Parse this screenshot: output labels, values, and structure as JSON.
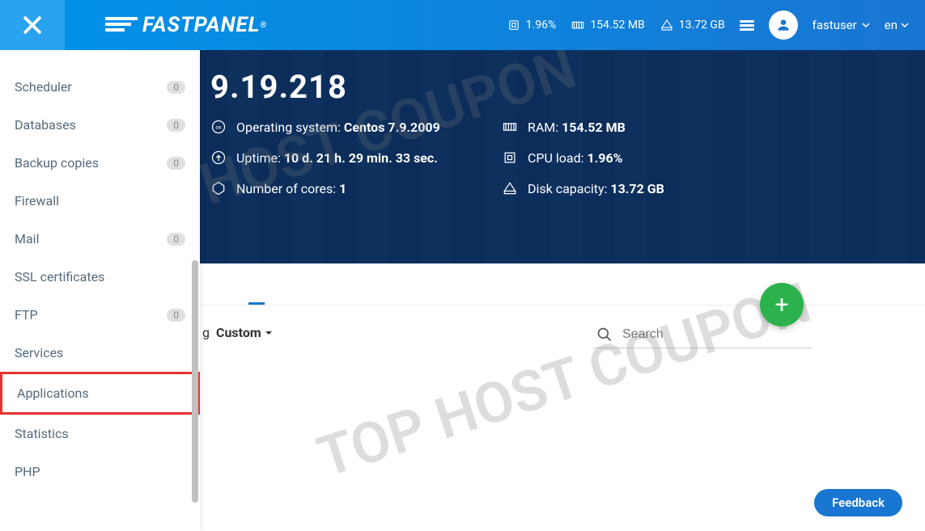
{
  "header": {
    "logo_text": "FASTPANEL",
    "logo_reg": "®",
    "cpu": "1.96%",
    "ram": "154.52 MB",
    "disk": "13.72 GB",
    "user": "fastuser",
    "lang": "en"
  },
  "sidebar": {
    "items": [
      {
        "label": "Scheduler",
        "badge": "0"
      },
      {
        "label": "Databases",
        "badge": "0"
      },
      {
        "label": "Backup copies",
        "badge": "0"
      },
      {
        "label": "Firewall",
        "badge": null
      },
      {
        "label": "Mail",
        "badge": "0"
      },
      {
        "label": "SSL certificates",
        "badge": null
      },
      {
        "label": "FTP",
        "badge": "0"
      },
      {
        "label": "Services",
        "badge": null
      },
      {
        "label": "Applications",
        "badge": null,
        "highlight": true
      },
      {
        "label": "Statistics",
        "badge": null
      },
      {
        "label": "PHP",
        "badge": null
      }
    ]
  },
  "hero": {
    "ip_partial": "9.19.218",
    "os_label": "Operating system: ",
    "os_value": "Centos 7.9.2009",
    "ram_label": "RAM: ",
    "ram_value": "154.52 MB",
    "uptime_label": "Uptime: ",
    "uptime_value": "10 d. 21 h. 29 min. 33 sec.",
    "cpu_label": "CPU load: ",
    "cpu_value": "1.96%",
    "cores_label": "Number of cores: ",
    "cores_value": "1",
    "disk_label": "Disk capacity: ",
    "disk_value": "13.72 GB"
  },
  "filters": {
    "sorting_suffix": "g",
    "custom": "Custom"
  },
  "search": {
    "placeholder": "Search"
  },
  "feedback": "Feedback",
  "watermark": "TOP HOST COUPON"
}
